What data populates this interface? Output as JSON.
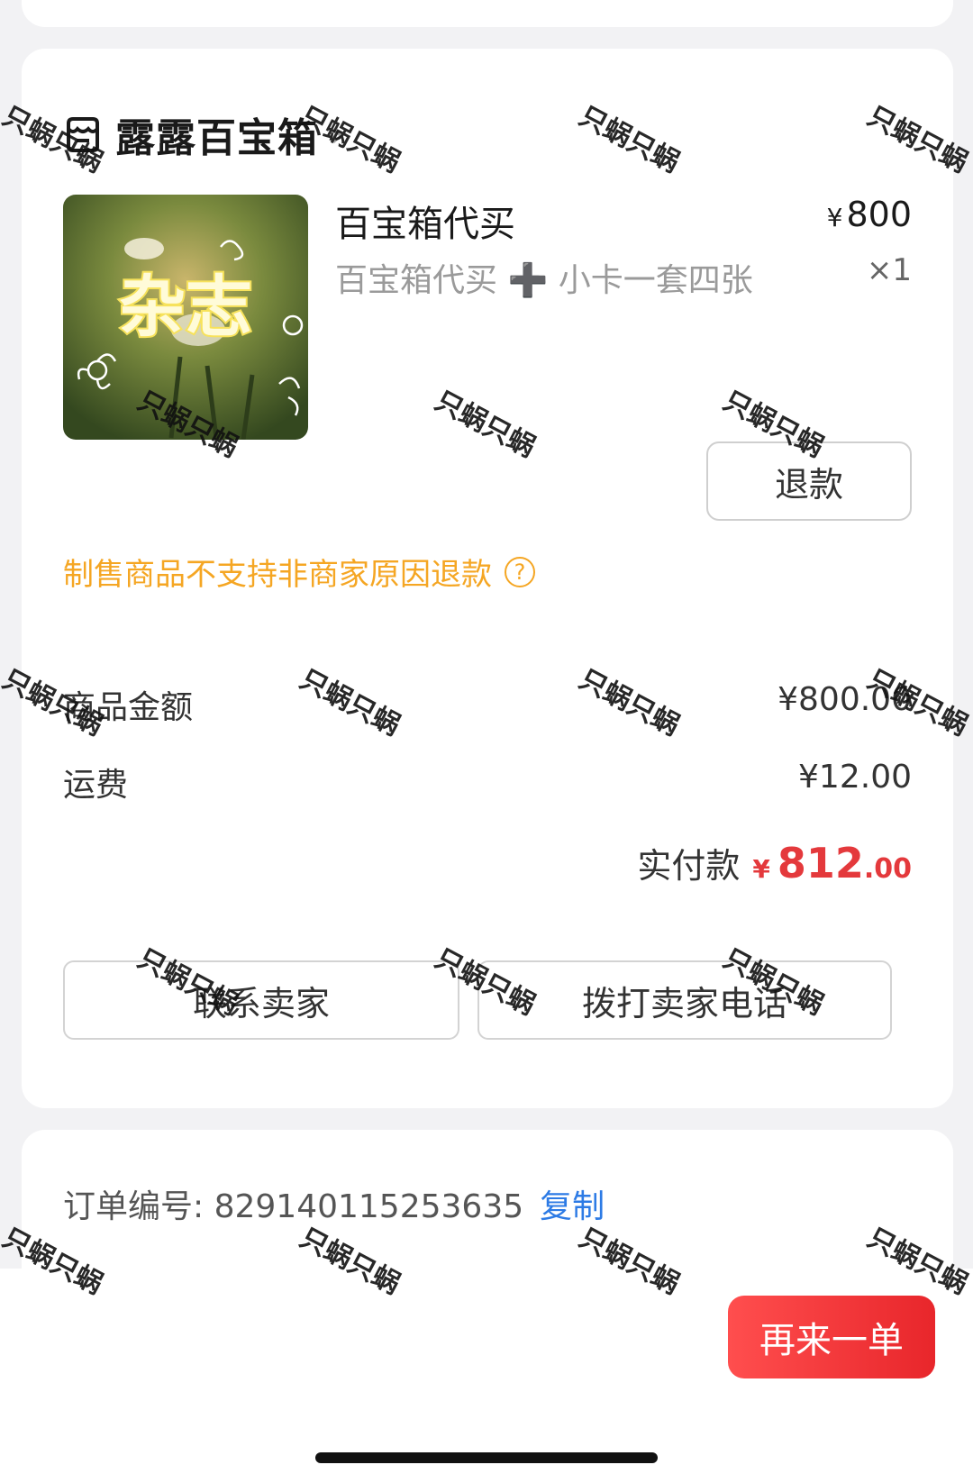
{
  "shop": {
    "name": "露露百宝箱",
    "arrow": "›"
  },
  "item": {
    "title": "百宝箱代买",
    "spec": "百宝箱代买 ➕ 小卡一套四张",
    "price_currency": "¥",
    "price": "800",
    "quantity": "×1",
    "thumbnail_text": "杂志"
  },
  "refund_button": "退款",
  "notice": {
    "text": "制售商品不支持非商家原因退款",
    "help_icon": "?"
  },
  "summary": {
    "goods_label": "商品金额",
    "goods_value": "¥800.00",
    "shipping_label": "运费",
    "shipping_value": "¥12.00",
    "paid_label": "实付款",
    "paid_currency": "¥",
    "paid_integer": "812",
    "paid_decimal": ".00"
  },
  "actions": {
    "contact_seller": "联系卖家",
    "call_seller": "拨打卖家电话"
  },
  "order": {
    "label": "订单编号: 829140115253635",
    "copy": "复制"
  },
  "bottom": {
    "reorder": "再来一单"
  },
  "watermark": "只蜗只蜗",
  "colors": {
    "price_red": "#e4393c",
    "notice_orange": "#f5a623",
    "link_blue": "#2d7be5",
    "button_red": "#e8262b"
  }
}
